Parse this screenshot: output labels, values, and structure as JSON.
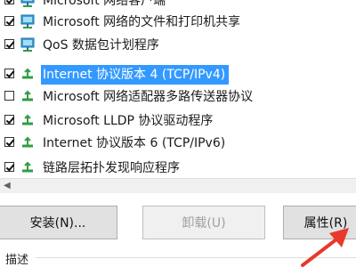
{
  "components": [
    {
      "label": "Microsoft 网络客户端",
      "checked": true,
      "selected": false,
      "icon": "network-client-icon"
    },
    {
      "label": "Microsoft 网络的文件和打印机共享",
      "checked": true,
      "selected": false,
      "icon": "network-client-icon"
    },
    {
      "label": "QoS 数据包计划程序",
      "checked": true,
      "selected": false,
      "icon": "network-client-icon"
    },
    {
      "label": "Internet 协议版本 4 (TCP/IPv4)",
      "checked": true,
      "selected": true,
      "icon": "protocol-icon"
    },
    {
      "label": "Microsoft 网络适配器多路传送器协议",
      "checked": false,
      "selected": false,
      "icon": "protocol-icon"
    },
    {
      "label": "Microsoft LLDP 协议驱动程序",
      "checked": true,
      "selected": false,
      "icon": "protocol-icon"
    },
    {
      "label": "Internet 协议版本 6 (TCP/IPv6)",
      "checked": true,
      "selected": false,
      "icon": "protocol-icon"
    },
    {
      "label": "链路层拓扑发现响应程序",
      "checked": true,
      "selected": false,
      "icon": "protocol-icon"
    }
  ],
  "buttons": {
    "install": "安装(N)...",
    "uninstall": "卸载(U)",
    "properties": "属性(R)"
  },
  "description_label": "描述",
  "colors": {
    "selection": "#3399ff",
    "annotation_arrow": "#e8392b"
  }
}
